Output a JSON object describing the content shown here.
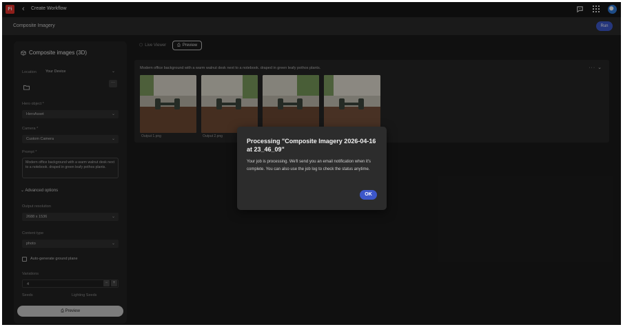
{
  "topbar": {
    "logo_text": "Fi",
    "back_glyph": "‹",
    "title": "Create Workflow",
    "icons": [
      "feedback-icon",
      "app-grid-icon",
      "profile-avatar"
    ]
  },
  "subbar": {
    "title": "Composite Imagery",
    "run_label": "Run"
  },
  "panel": {
    "title": "Composite images (3D)",
    "location_label": "Location",
    "location_value": "Your Device",
    "more_glyph": "···",
    "hero_label": "Hero object *",
    "hero_value": "HeroAsset",
    "camera_label": "Camera *",
    "camera_value": "Custom Camera",
    "prompt_label": "Prompt *",
    "prompt_value": "Modern office background with a warm walnut desk next to a notebook. draped in green leafy pothos plants.",
    "advanced_label": "Advanced options",
    "resolution_label": "Output resolution",
    "resolution_value": "2688 x 1536",
    "content_type_label": "Content type",
    "content_type_value": "photo",
    "ground_plane_label": "Auto-generate ground plane",
    "variations_label": "Variations",
    "variations_value": "4",
    "stepper_minus": "−",
    "stepper_plus": "+",
    "seeds_label": "Seeds",
    "lighting_seeds_label": "Lighting Seeds",
    "preview_label": "Preview"
  },
  "view_tabs": {
    "live_viewer": "Live Viewer",
    "preview": "Preview"
  },
  "results": {
    "prompt": "Modern office background with a warm walnut desk next to a notebook. draped in green leafy pothos plants.",
    "tools": "··· ⌄",
    "outputs": [
      "Output 1.png",
      "Output 2.png",
      "",
      ""
    ]
  },
  "dialog": {
    "title": "Processing \"Composite Imagery 2026-04-16 at 23_46_09\"",
    "body": "Your job is processing. We'll send you an email notification when it's complete. You can also use the job log to check the status anytime.",
    "ok_label": "OK"
  },
  "colors": {
    "accent": "#3d57c9",
    "background": "#1b1b1b",
    "panel": "#232323",
    "logo": "#e4312b"
  }
}
